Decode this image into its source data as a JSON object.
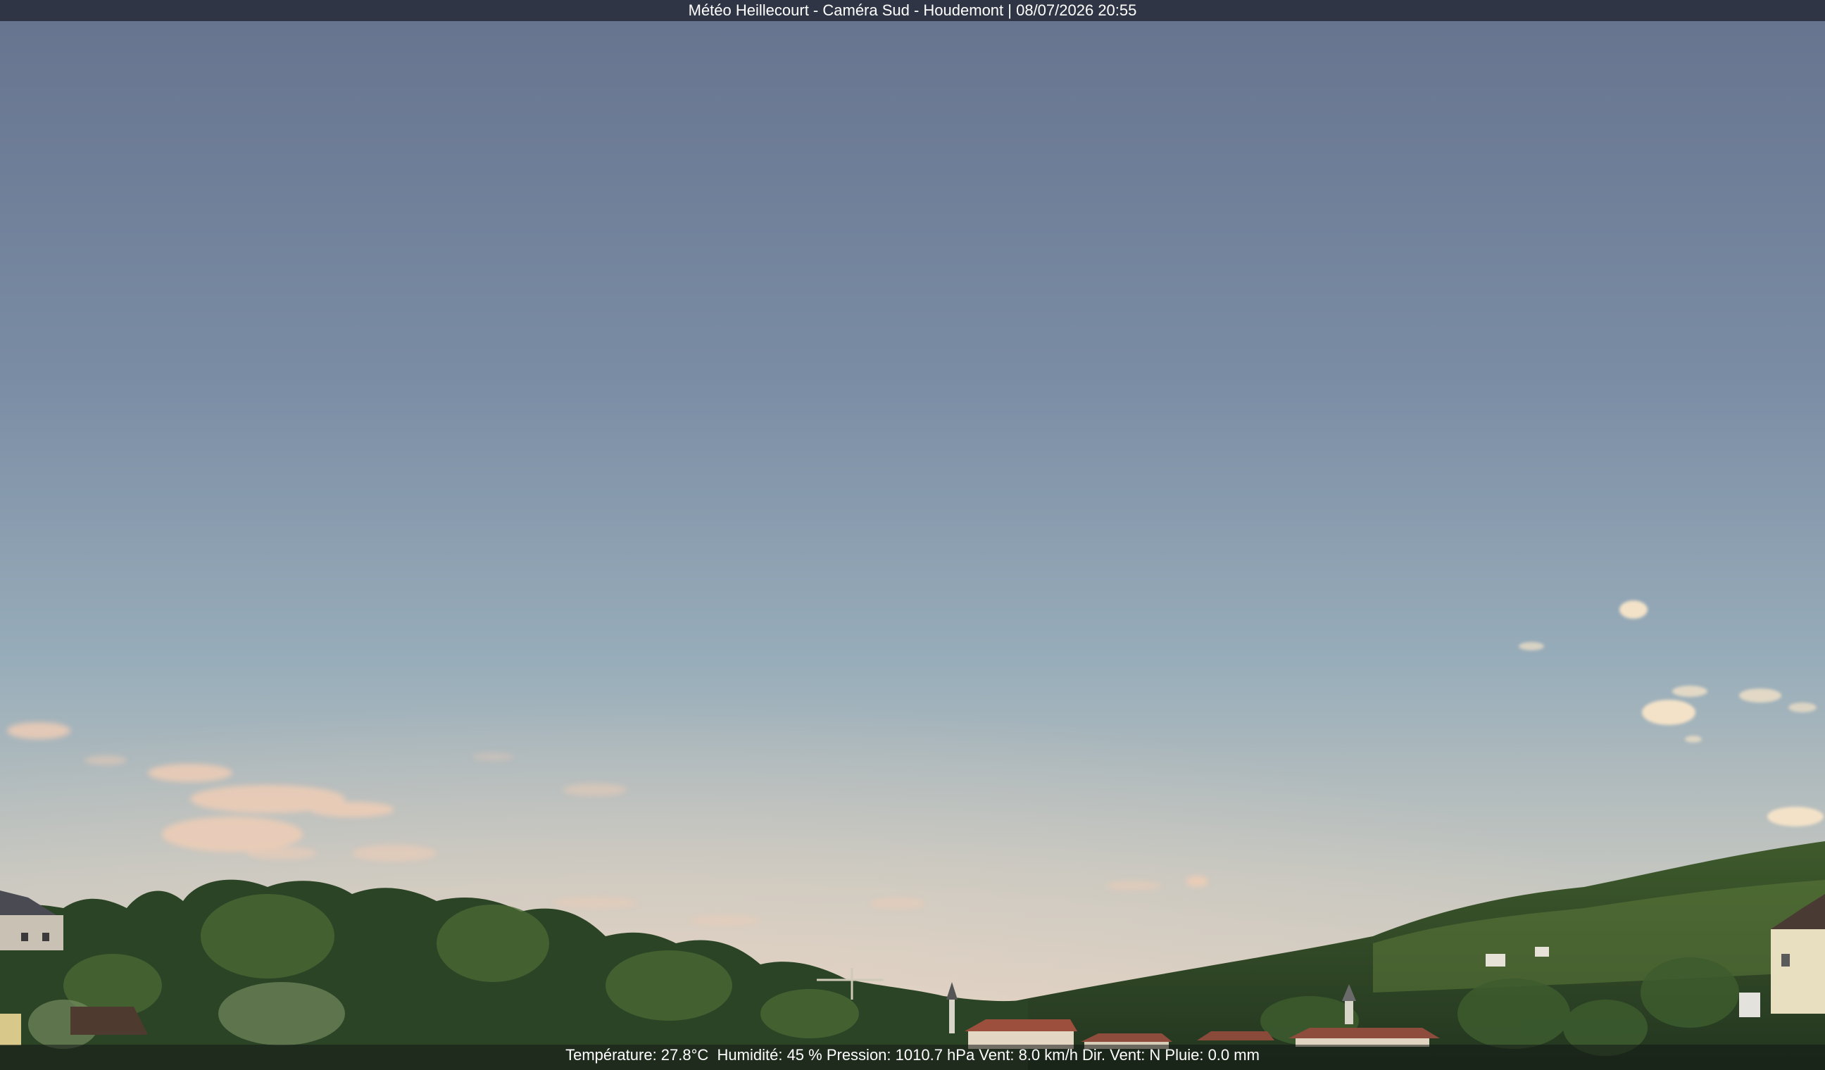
{
  "overlay": {
    "title": "Météo Heillecourt - Caméra Sud - Houdemont | 08/07/2026 20:55",
    "weather": "Température: 27.8°C  Humidité: 45 % Pression: 1010.7 hPa Vent: 8.0 km/h Dir. Vent: N Pluie: 0.0 mm"
  },
  "scene": {
    "subject": "webcam-view-evening-sky-over-wooded-hills-and-village",
    "colors": {
      "sky_top": "#6b7892",
      "sky_mid": "#8fa3b4",
      "sky_horizon": "#d9cfc2",
      "clouds": "#efcfb8",
      "trees_dark": "#243820",
      "trees_light": "#4f6e36",
      "roofs": "#8a4a3a"
    }
  }
}
